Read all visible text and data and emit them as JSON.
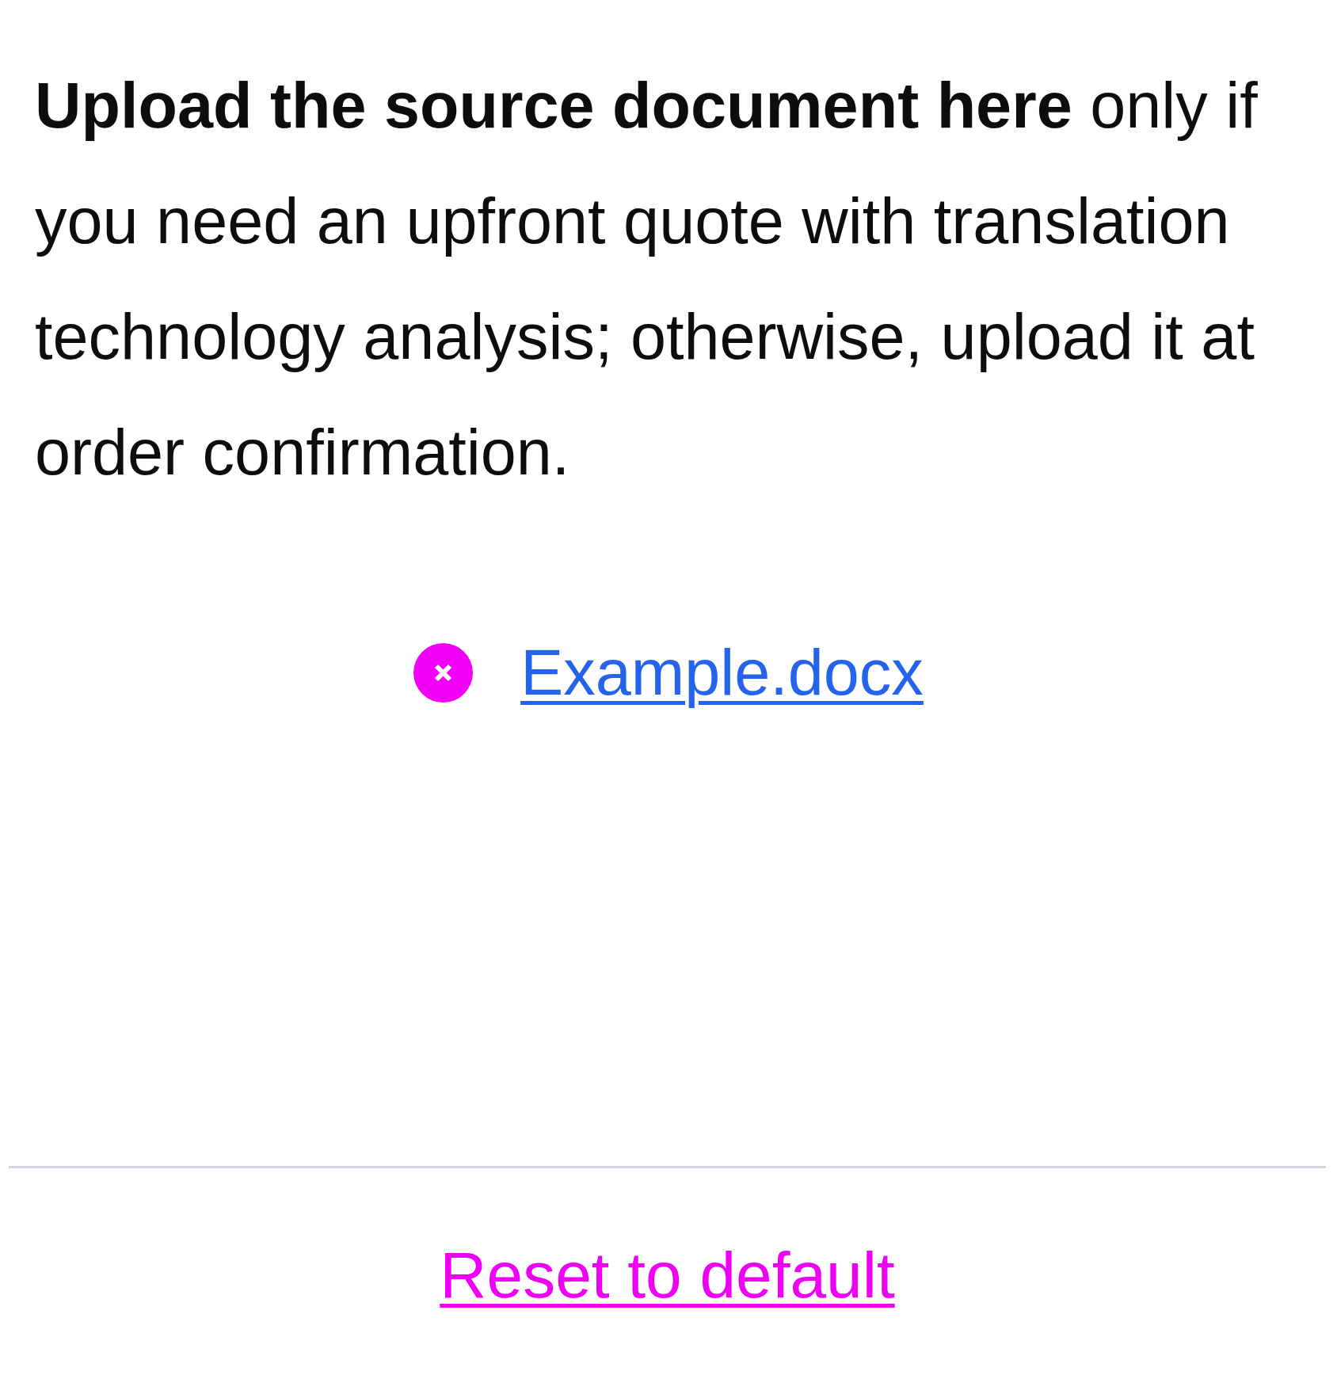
{
  "instructions": {
    "text": "**Upload the source document here** only if you need an upfront quote with translation technology analysis; otherwise, upload it at order confirmation."
  },
  "attachment": {
    "file_name": "Example.docx"
  },
  "footer": {
    "reset_link": "Reset to default"
  }
}
